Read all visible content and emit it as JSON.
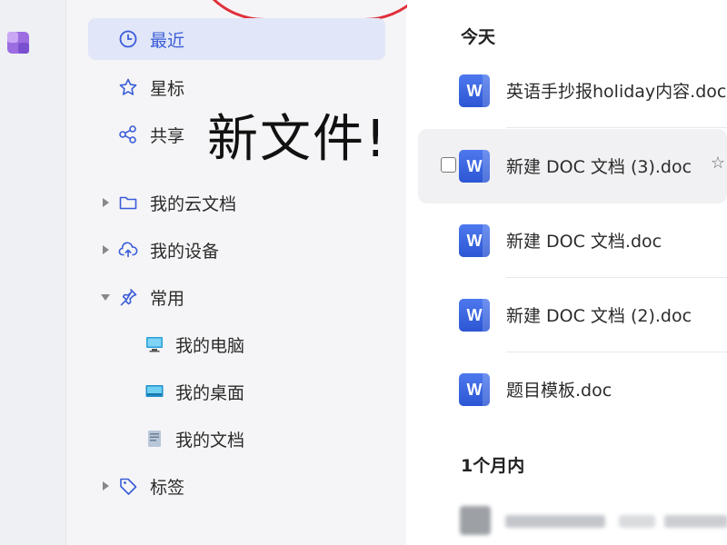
{
  "nav": {
    "items": [
      {
        "label": "最近",
        "icon": "clock-icon",
        "active": true
      },
      {
        "label": "星标",
        "icon": "star-icon"
      },
      {
        "label": "共享",
        "icon": "share-icon"
      },
      {
        "label": "我的云文档",
        "icon": "folder-icon"
      },
      {
        "label": "我的设备",
        "icon": "cloud-upload-icon"
      },
      {
        "label": "常用",
        "icon": "pin-icon"
      },
      {
        "label": "标签",
        "icon": "tag-icon"
      }
    ],
    "sub_items": [
      {
        "label": "我的电脑",
        "icon": "computer-icon"
      },
      {
        "label": "我的桌面",
        "icon": "desktop-icon"
      },
      {
        "label": "我的文档",
        "icon": "document-icon"
      }
    ]
  },
  "annotation": {
    "text": "新文件!",
    "color": "#e0303a"
  },
  "main": {
    "groups": [
      {
        "title": "今天",
        "files": [
          {
            "name": "英语手抄报holiday内容.doc",
            "icon": "W"
          },
          {
            "name": "新建 DOC 文档 (3).doc",
            "icon": "W"
          },
          {
            "name": "新建 DOC 文档.doc",
            "icon": "W"
          },
          {
            "name": "新建 DOC 文档 (2).doc",
            "icon": "W"
          },
          {
            "name": "题目模板.doc",
            "icon": "W"
          }
        ]
      },
      {
        "title": "1个月内",
        "files": []
      }
    ]
  },
  "colors": {
    "accent": "#3a5cd8",
    "active_bg": "#e1e6f8",
    "word_blue": "#2c56d3"
  }
}
